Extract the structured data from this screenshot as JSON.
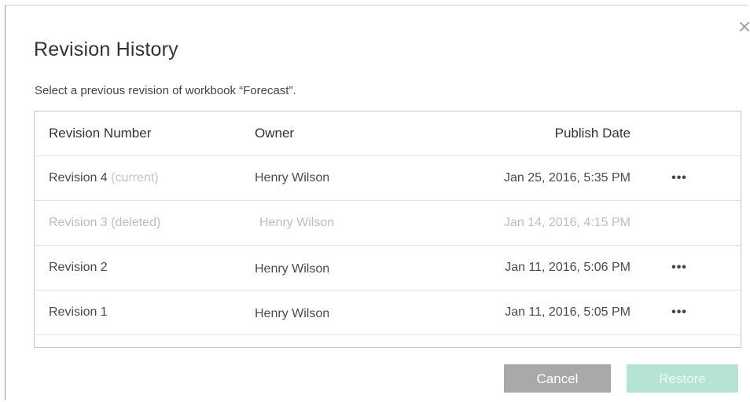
{
  "dialog": {
    "title": "Revision History",
    "subtitle": "Select a previous revision of workbook “Forecast”.",
    "close_glyph": "×"
  },
  "table": {
    "headers": {
      "revision": "Revision Number",
      "owner": "Owner",
      "date": "Publish Date"
    },
    "rows": [
      {
        "revision": "Revision 4",
        "tag": "(current)",
        "owner": "Henry Wilson",
        "date": "Jan 25, 2016, 5:35 PM",
        "more": "•••",
        "state": "current"
      },
      {
        "revision": "Revision 3",
        "tag": "(deleted)",
        "owner": "Henry Wilson",
        "date": "Jan 14, 2016, 4:15 PM",
        "more": "",
        "state": "deleted"
      },
      {
        "revision": "Revision 2",
        "tag": "",
        "owner": "Henry Wilson",
        "date": "Jan 11, 2016, 5:06 PM",
        "more": "•••",
        "state": "normal"
      },
      {
        "revision": "Revision 1",
        "tag": "",
        "owner": "Henry Wilson",
        "date": "Jan 11, 2016, 5:05 PM",
        "more": "•••",
        "state": "normal"
      }
    ]
  },
  "buttons": {
    "cancel": "Cancel",
    "restore": "Restore"
  },
  "colors": {
    "cancel_bg": "#a9a9a9",
    "restore_bg_disabled": "#b5e4d4",
    "muted_text": "#c4c4c4"
  },
  "icons": {
    "close": "close-icon",
    "more": "more-options-icon"
  }
}
